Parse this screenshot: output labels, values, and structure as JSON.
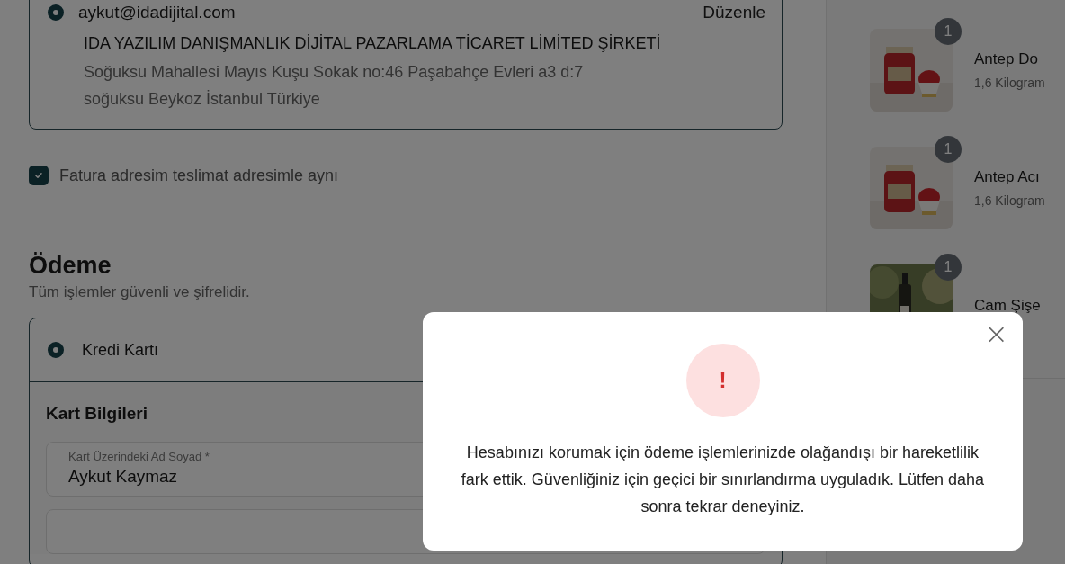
{
  "delivery_address": {
    "selected": true,
    "email": "aykut@idadijital.com",
    "edit_link": "Düzenle",
    "company": "IDA YAZILIM DANIŞMANLIK DİJİTAL PAZARLAMA TİCARET LİMİTED ŞİRKETİ",
    "address_lines": [
      "Soğuksu Mahallesi Mayıs Kuşu Sokak no:46 Paşabahçe Evleri a3 d:7",
      "soğuksu Beykoz İstanbul Türkiye"
    ]
  },
  "billing_same": {
    "label": "Fatura adresim teslimat adresimle aynı",
    "checked": true
  },
  "payment": {
    "title": "Ödeme",
    "subtitle": "Tüm işlemler güvenli ve şifrelidir.",
    "method": {
      "label": "Kredi Kartı",
      "selected": true
    },
    "card_title": "Kart Bilgileri",
    "fields": [
      {
        "label": "Kart Üzerindeki Ad Soyad *",
        "value": "Aykut Kaymaz"
      }
    ]
  },
  "cart_items": [
    {
      "quantity": "1",
      "name": "Antep Do",
      "detail": "1,6 Kilogram",
      "kind": "picture"
    },
    {
      "quantity": "1",
      "name": "Antep Acı",
      "detail": "1,6 Kilogram",
      "kind": "picture"
    },
    {
      "quantity": "1",
      "name": "Cam Şişe",
      "kind": "picture"
    }
  ],
  "dialog": {
    "message": "Hesabınızı korumak için ödeme işlemlerinizde olağandışı bir hareketlilik fark ettik. Güvenliğiniz için geçici bir sınırlandırma uyguladık. Lütfen daha sonra tekrar deneyiniz.",
    "icon_text": "!",
    "close": "×"
  }
}
